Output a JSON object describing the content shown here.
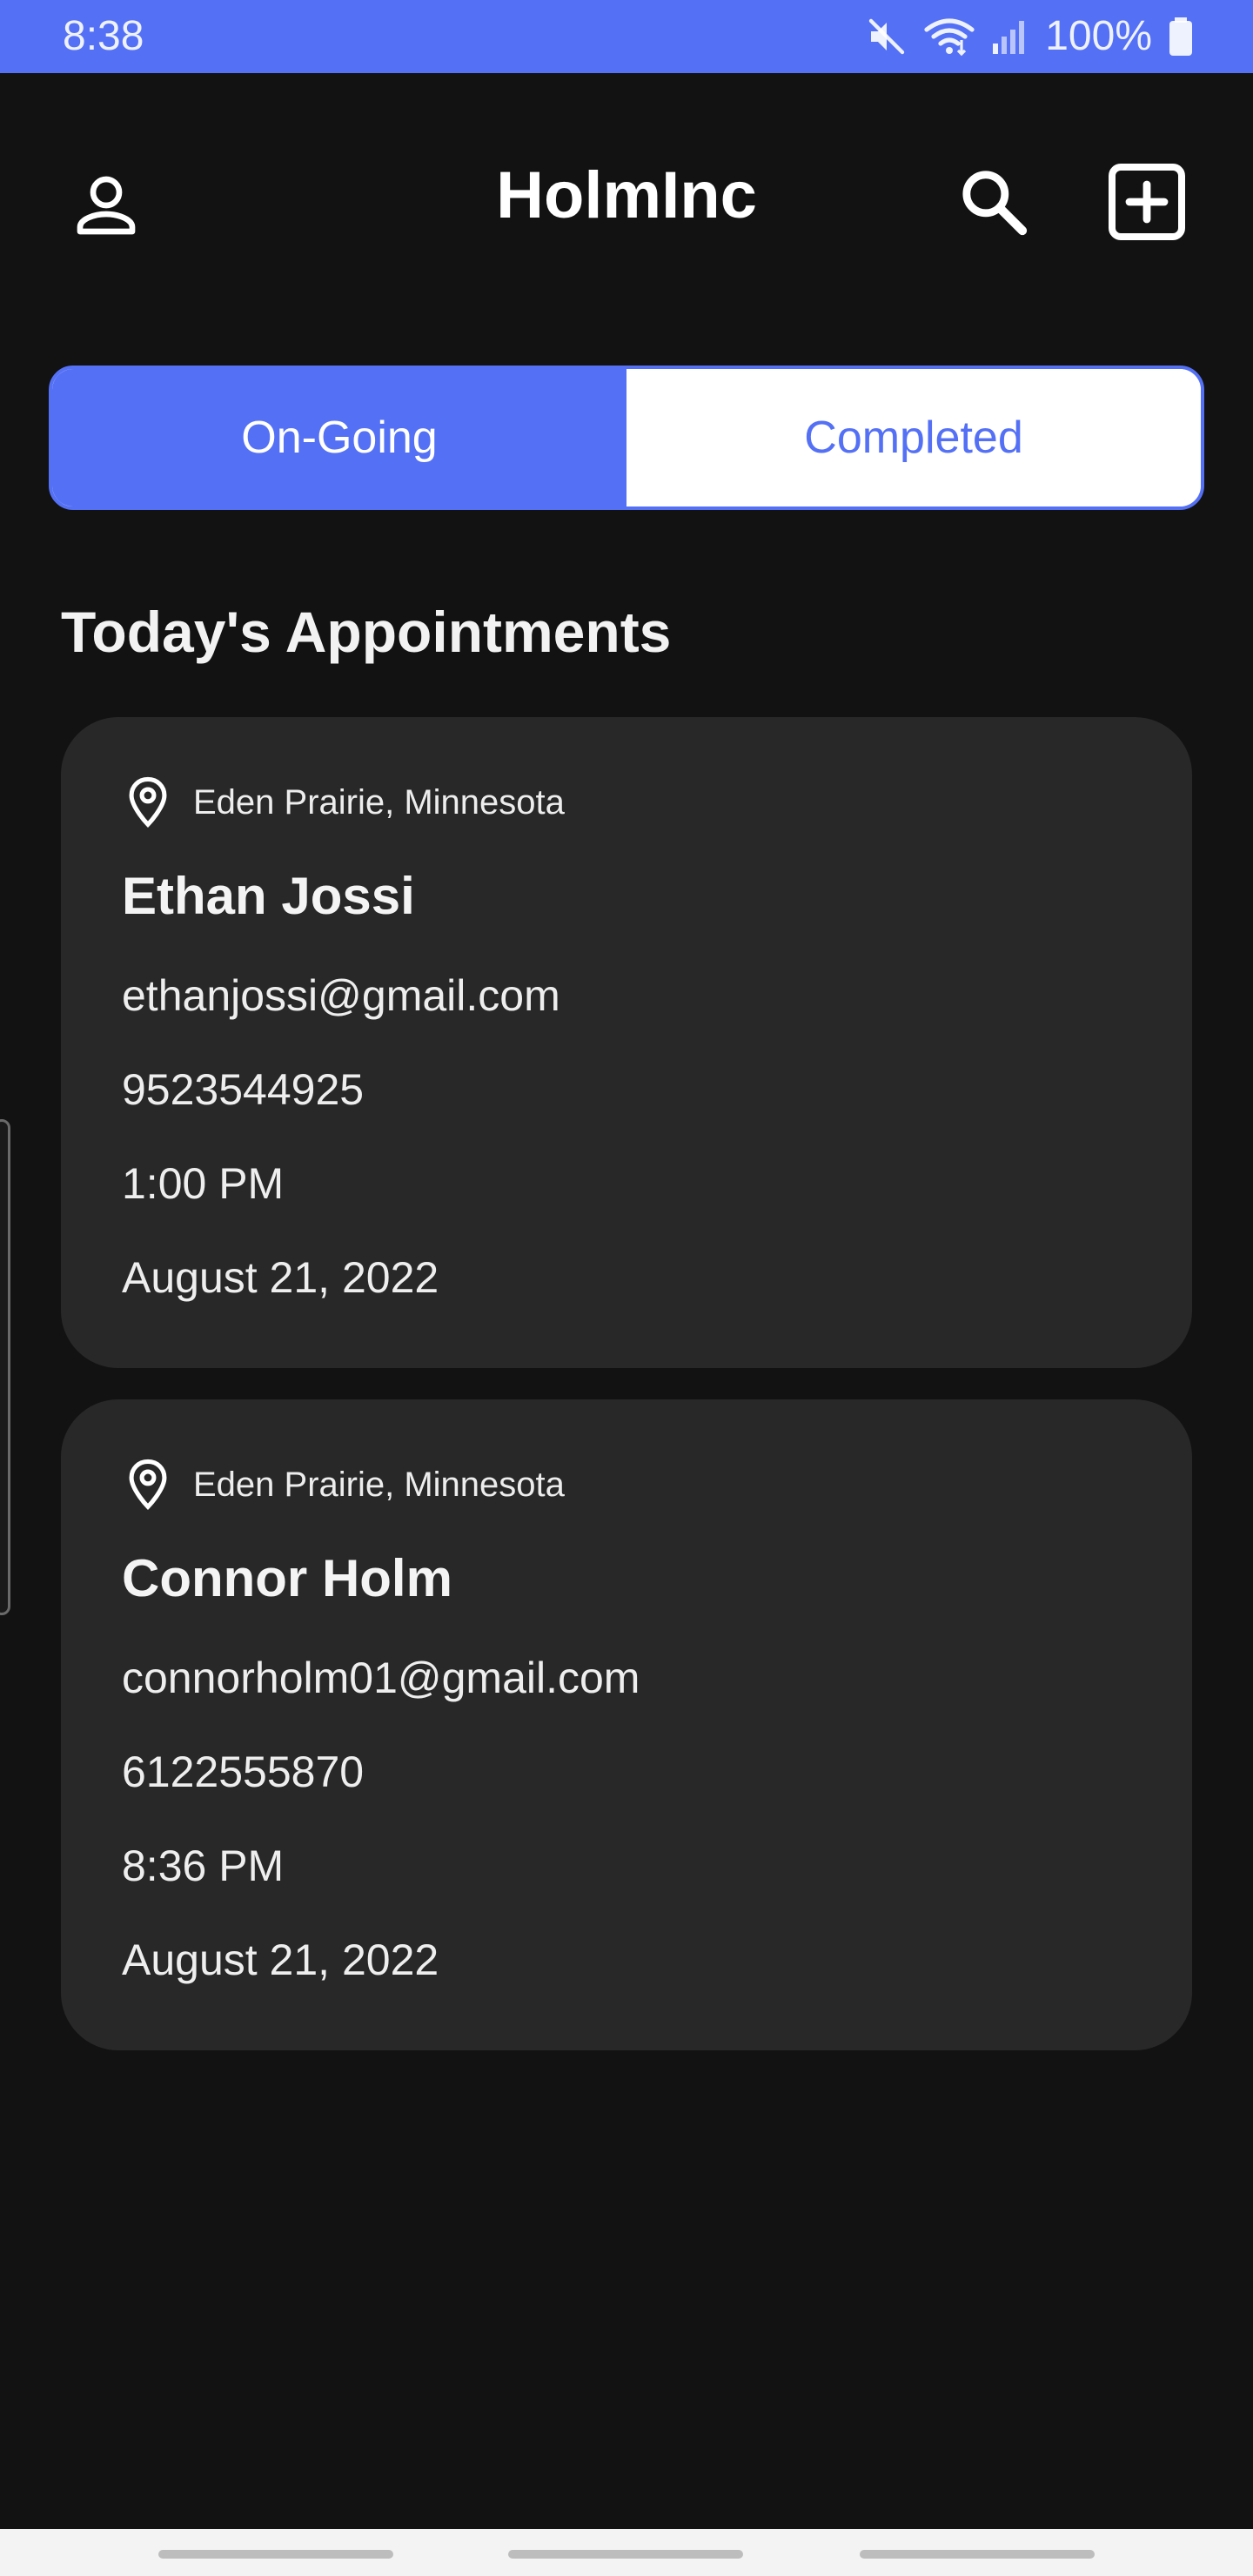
{
  "status_bar": {
    "time": "8:38",
    "battery": "100%",
    "icons": [
      "mute-icon",
      "wifi-icon",
      "signal-icon",
      "battery-icon"
    ],
    "background": "#5470f5"
  },
  "app_bar": {
    "title": "HolmInc",
    "left_icon": "profile-icon",
    "right_icons": [
      "search-icon",
      "add-box-icon"
    ]
  },
  "tabs": [
    {
      "label": "On-Going",
      "selected": true
    },
    {
      "label": "Completed",
      "selected": false
    }
  ],
  "section_title": "Today's Appointments",
  "appointments": [
    {
      "location": "Eden Prairie, Minnesota",
      "name": "Ethan Jossi",
      "email": "ethanjossi@gmail.com",
      "phone": "9523544925",
      "time": "1:00 PM",
      "date": "August 21, 2022"
    },
    {
      "location": "Eden Prairie, Minnesota",
      "name": "Connor Holm",
      "email": "connorholm01@gmail.com",
      "phone": "6122555870",
      "time": "8:36 PM",
      "date": "August 21, 2022"
    }
  ],
  "colors": {
    "accent": "#5470f5",
    "background": "#121212",
    "card": "#282828"
  }
}
